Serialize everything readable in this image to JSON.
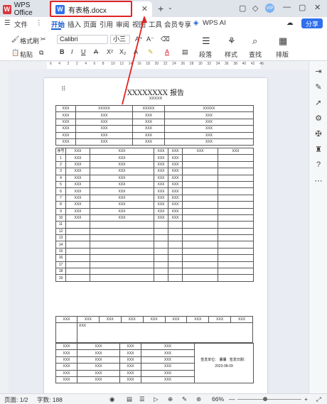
{
  "tabs": {
    "wps_label": "WPS Office",
    "doc_label": "有表格.docx",
    "logo_letter": "W"
  },
  "menu": {
    "file": "文件",
    "items": [
      "开始",
      "插入",
      "页面",
      "引用",
      "审阅",
      "视图",
      "工具",
      "会员专享"
    ],
    "wps_ai": "WPS AI",
    "share": "分享"
  },
  "ribbon": {
    "format_painter": "格式刷",
    "paste": "粘贴",
    "font_name": "Calibri",
    "font_size": "小三",
    "paragraph": "段落",
    "style": "样式",
    "find": "查找",
    "layout": "排版"
  },
  "ruler_numbers": [
    "6",
    "4",
    "2",
    "2",
    "4",
    "6",
    "8",
    "10",
    "12",
    "14",
    "16",
    "18",
    "20",
    "22",
    "24",
    "26",
    "28",
    "30",
    "32",
    "34",
    "36",
    "38",
    "40",
    "42",
    "46"
  ],
  "document": {
    "title": "XXXXXXXX 报告",
    "subtitle": "XXXXX",
    "cell": "XXX",
    "cell_long": "XXXXX",
    "seq_header": "序号",
    "row_numbers": [
      "1",
      "2",
      "3",
      "4",
      "5",
      "6",
      "7",
      "8",
      "9",
      "10",
      "11",
      "12",
      "13",
      "14",
      "15",
      "16",
      "17",
      "18",
      "19"
    ],
    "sign_unit": "签发单位：",
    "sign_unit_value": "曩曩",
    "sign_date": "签发日期：",
    "sign_date_value": "2023-08-09"
  },
  "status": {
    "page": "页面: 1/2",
    "words": "字数: 188",
    "zoom": "66%"
  }
}
